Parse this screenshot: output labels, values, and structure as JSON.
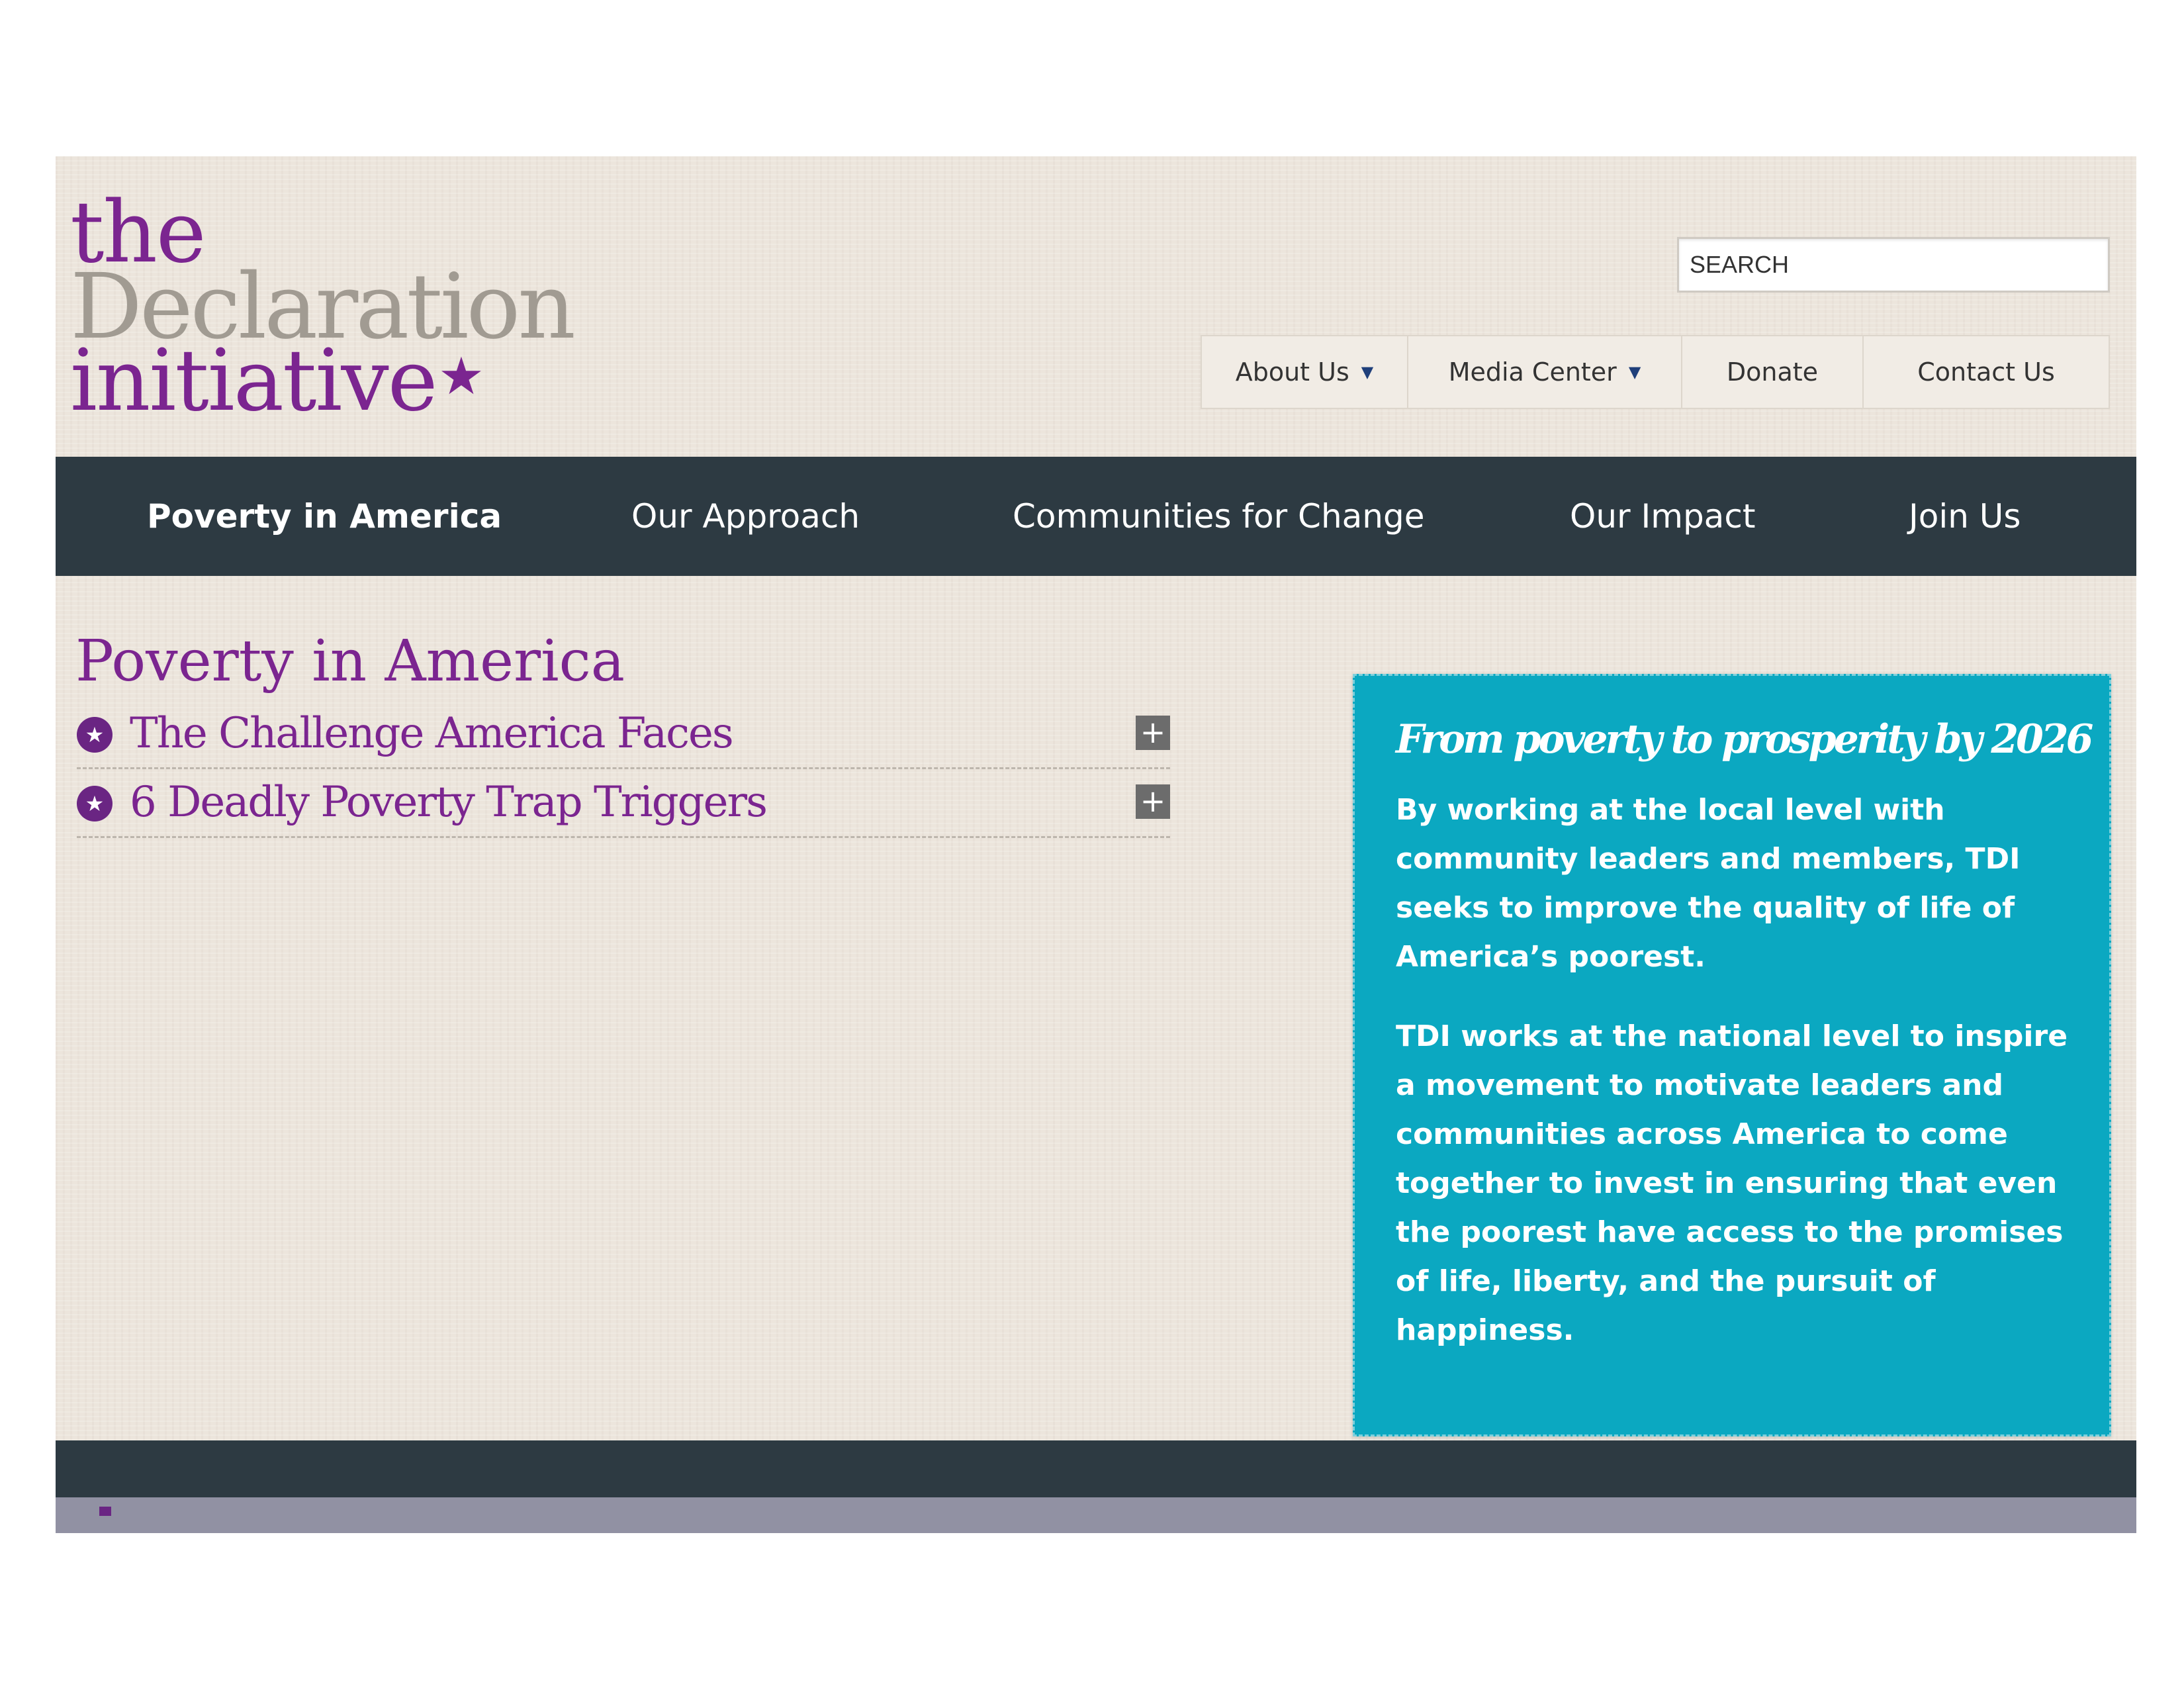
{
  "logo": {
    "line1": "the",
    "line2": "Declaration",
    "line3": "initiative",
    "star": "★"
  },
  "search": {
    "placeholder": "SEARCH"
  },
  "utility_nav": [
    {
      "label": "About Us",
      "has_dropdown": true
    },
    {
      "label": "Media Center",
      "has_dropdown": true
    },
    {
      "label": "Donate",
      "has_dropdown": false
    },
    {
      "label": "Contact Us",
      "has_dropdown": false
    }
  ],
  "dropdown_caret": "▼",
  "main_nav": [
    {
      "label": "Poverty in America",
      "active": true
    },
    {
      "label": "Our Approach",
      "active": false
    },
    {
      "label": "Communities for Change",
      "active": false
    },
    {
      "label": "Our Impact",
      "active": false
    },
    {
      "label": "Join Us",
      "active": false
    }
  ],
  "content": {
    "title": "Poverty in America",
    "items": [
      {
        "label": "The Challenge America Faces",
        "icon": "star-circle-icon",
        "toggle": "+"
      },
      {
        "label": "6 Deadly Poverty Trap Triggers",
        "icon": "star-circle-icon",
        "toggle": "+"
      }
    ]
  },
  "sidebar": {
    "title": "From poverty to prosperity by 2026",
    "paragraphs": [
      "By working at the local level with community leaders and members, TDI seeks to improve the quality of life of America’s poorest.",
      "TDI works at the national level to inspire a movement to motivate leaders and communities across America to come together to invest in ensuring that even the poorest have access to the promises of life, liberty, and the pursuit of happiness."
    ]
  },
  "colors": {
    "brand_purple": "#7b2590",
    "logo_gray": "#a19b92",
    "nav_dark": "#2d3a42",
    "info_teal": "#0ba8c1",
    "page_background": "#ece5dc"
  }
}
